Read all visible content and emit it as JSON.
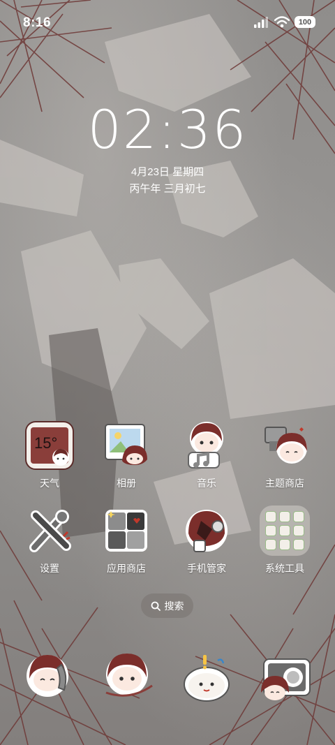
{
  "status_bar": {
    "time": "8:16",
    "battery": "100"
  },
  "lockclock": {
    "time": "02:36",
    "date": "4月23日 星期四",
    "lunar": "丙午年 三月初七"
  },
  "weather_widget": {
    "temp": "15°"
  },
  "apps_row1": [
    {
      "label": "天气",
      "icon": "weather-icon"
    },
    {
      "label": "相册",
      "icon": "gallery-icon"
    },
    {
      "label": "音乐",
      "icon": "music-icon"
    },
    {
      "label": "主题商店",
      "icon": "theme-store-icon"
    }
  ],
  "apps_row2": [
    {
      "label": "设置",
      "icon": "settings-icon"
    },
    {
      "label": "应用商店",
      "icon": "app-store-icon"
    },
    {
      "label": "手机管家",
      "icon": "phone-manager-icon"
    },
    {
      "label": "系统工具",
      "icon": "folder-icon"
    }
  ],
  "search": {
    "label": "搜索"
  },
  "dock": [
    {
      "icon": "phone-icon"
    },
    {
      "icon": "messages-icon"
    },
    {
      "icon": "browser-icon"
    },
    {
      "icon": "camera-icon"
    }
  ],
  "colors": {
    "accent": "#7a3b38",
    "icon_bg": "#f1ede7"
  }
}
